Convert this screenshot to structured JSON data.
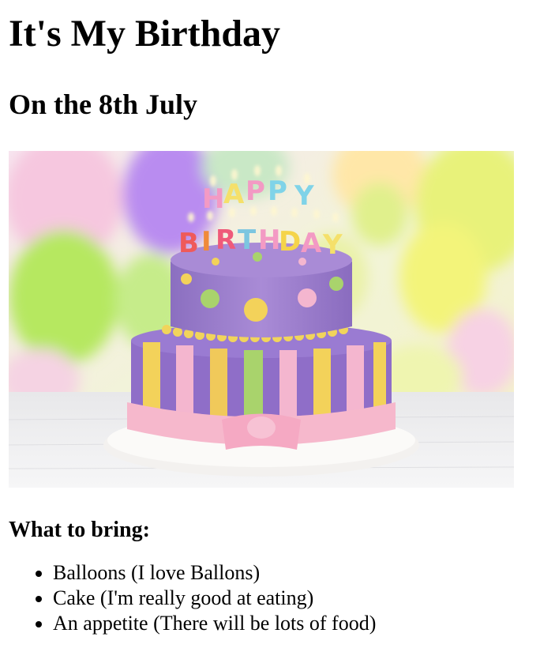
{
  "page": {
    "title": "It's My Birthday",
    "subtitle": "On the 8th July",
    "image": {
      "icon": "birthday-cake-photo"
    },
    "bring_heading": "What to bring:",
    "bring_items": [
      {
        "text": "Balloons (I love Ballons)"
      },
      {
        "text": "Cake (I'm really good at eating)"
      },
      {
        "text": "An appetite (There will be lots of food)"
      }
    ]
  },
  "colors": {
    "text": "#000000",
    "background": "#ffffff"
  }
}
